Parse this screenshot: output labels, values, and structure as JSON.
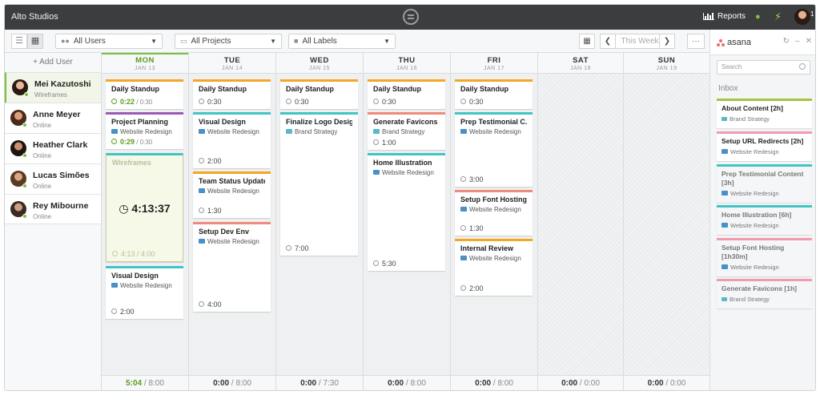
{
  "window": {
    "title": "Alto Studios"
  },
  "topbar": {
    "reports_label": "Reports",
    "notification_count": "1"
  },
  "toolbar": {
    "users_filter": "All Users",
    "projects_filter": "All Projects",
    "labels_filter": "All Labels",
    "week_label": "This Week",
    "more_label": "···"
  },
  "sidebar": {
    "add_user_label": "+ Add User",
    "users": [
      {
        "name": "Mei Kazutoshi",
        "status": "Wireframes"
      },
      {
        "name": "Anne Meyer",
        "status": "Online"
      },
      {
        "name": "Heather Clark",
        "status": "Online"
      },
      {
        "name": "Lucas Simões",
        "status": "Online"
      },
      {
        "name": "Rey Mibourne",
        "status": "Online"
      }
    ]
  },
  "days": [
    {
      "name": "MON",
      "date": "JAN 13",
      "tracked": "5:04",
      "planned": "8:00"
    },
    {
      "name": "TUE",
      "date": "JAN 14",
      "tracked": "0:00",
      "planned": "8:00"
    },
    {
      "name": "WED",
      "date": "JAN 15",
      "tracked": "0:00",
      "planned": "7:30"
    },
    {
      "name": "THU",
      "date": "JAN 16",
      "tracked": "0:00",
      "planned": "8:00"
    },
    {
      "name": "FRI",
      "date": "JAN 17",
      "tracked": "0:00",
      "planned": "8:00"
    },
    {
      "name": "SAT",
      "date": "JAN 18",
      "tracked": "0:00",
      "planned": "0:00"
    },
    {
      "name": "SUN",
      "date": "JAN 19",
      "tracked": "0:00",
      "planned": "0:00"
    }
  ],
  "tasks": {
    "mon": [
      {
        "title": "Daily Standup",
        "tracked": "0:22",
        "estimate": "0:30"
      },
      {
        "title": "Project Planning",
        "project": "Website Redesign",
        "tracked": "0:29",
        "estimate": "0:30"
      },
      {
        "title": "Wireframes",
        "timer": "4:13:37",
        "tracked": "4:13",
        "estimate": "4:00"
      },
      {
        "title": "Visual Design",
        "project": "Website Redesign",
        "time": "2:00"
      }
    ],
    "tue": [
      {
        "title": "Daily Standup",
        "time": "0:30"
      },
      {
        "title": "Visual Design",
        "project": "Website Redesign",
        "time": "2:00"
      },
      {
        "title": "Team Status Update",
        "project": "Website Redesign",
        "time": "1:30"
      },
      {
        "title": "Setup Dev Env",
        "project": "Website Redesign",
        "time": "4:00"
      }
    ],
    "wed": [
      {
        "title": "Daily Standup",
        "time": "0:30"
      },
      {
        "title": "Finalize Logo Design",
        "project": "Brand Strategy",
        "time": "7:00"
      }
    ],
    "thu": [
      {
        "title": "Daily Standup",
        "time": "0:30"
      },
      {
        "title": "Generate Favicons",
        "project": "Brand Strategy",
        "time": "1:00"
      },
      {
        "title": "Home Illustration",
        "project": "Website Redesign",
        "time": "5:30"
      }
    ],
    "fri": [
      {
        "title": "Daily Standup",
        "time": "0:30"
      },
      {
        "title": "Prep Testimonial C...",
        "project": "Website Redesign",
        "time": "3:00"
      },
      {
        "title": "Setup Font Hosting",
        "project": "Website Redesign",
        "time": "1:30"
      },
      {
        "title": "Internal Review",
        "project": "Website Redesign",
        "time": "2:00"
      }
    ]
  },
  "asana": {
    "brand": "asana",
    "search_placeholder": "Search",
    "inbox_label": "Inbox",
    "items": [
      {
        "title": "About Content [2h]",
        "project": "Brand Strategy"
      },
      {
        "title": "Setup URL Redirects [2h]",
        "project": "Website Redesign"
      },
      {
        "title": "Prep Testimonial Content [3h]",
        "project": "Website Redesign"
      },
      {
        "title": "Home Illustration [6h]",
        "project": "Website Redesign"
      },
      {
        "title": "Setup Font Hosting [1h30m]",
        "project": "Website Redesign"
      },
      {
        "title": "Generate Favicons [1h]",
        "project": "Brand Strategy"
      }
    ]
  },
  "colors": {
    "accent_green": "#7ac143",
    "orange": "#f5a623",
    "teal": "#41c4c4",
    "purple": "#9b59b6",
    "salmon": "#f08a7a",
    "pink": "#f39ab0"
  }
}
